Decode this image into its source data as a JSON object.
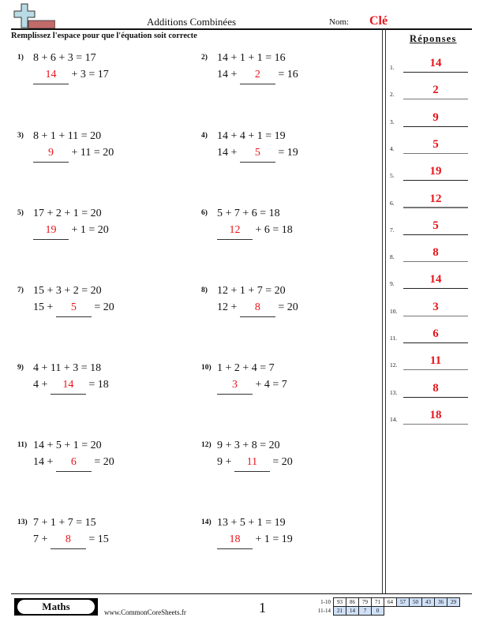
{
  "header": {
    "title": "Additions Combinées",
    "name_label": "Nom:",
    "name_value": "Clé",
    "instructions": "Remplissez l'espace pour que l'équation soit correcte",
    "logo_icon": "plus-sign-logo-icon"
  },
  "problems": [
    {
      "num": "1)",
      "line1": "8 + 6 + 3 = 17",
      "before": "",
      "answer": "14",
      "after": " + 3 = 17"
    },
    {
      "num": "2)",
      "line1": "14 + 1 + 1 = 16",
      "before": "14 + ",
      "answer": "2",
      "after": " = 16"
    },
    {
      "num": "3)",
      "line1": "8 + 1 + 11 = 20",
      "before": "",
      "answer": "9",
      "after": " + 11 = 20"
    },
    {
      "num": "4)",
      "line1": "14 + 4 + 1 = 19",
      "before": "14 + ",
      "answer": "5",
      "after": " = 19"
    },
    {
      "num": "5)",
      "line1": "17 + 2 + 1 = 20",
      "before": "",
      "answer": "19",
      "after": " + 1 = 20"
    },
    {
      "num": "6)",
      "line1": "5 + 7 + 6 = 18",
      "before": "",
      "answer": "12",
      "after": " + 6 = 18"
    },
    {
      "num": "7)",
      "line1": "15 + 3 + 2 = 20",
      "before": "15 + ",
      "answer": "5",
      "after": " = 20"
    },
    {
      "num": "8)",
      "line1": "12 + 1 + 7 = 20",
      "before": "12 + ",
      "answer": "8",
      "after": " = 20"
    },
    {
      "num": "9)",
      "line1": "4 + 11 + 3 = 18",
      "before": "4 + ",
      "answer": "14",
      "after": " = 18"
    },
    {
      "num": "10)",
      "line1": "1 + 2 + 4 = 7",
      "before": "",
      "answer": "3",
      "after": " + 4 = 7"
    },
    {
      "num": "11)",
      "line1": "14 + 5 + 1 = 20",
      "before": "14 + ",
      "answer": "6",
      "after": " = 20"
    },
    {
      "num": "12)",
      "line1": "9 + 3 + 8 = 20",
      "before": "9 + ",
      "answer": "11",
      "after": " = 20"
    },
    {
      "num": "13)",
      "line1": "7 + 1 + 7 = 15",
      "before": "7 + ",
      "answer": "8",
      "after": " = 15"
    },
    {
      "num": "14)",
      "line1": "13 + 5 + 1 = 19",
      "before": "",
      "answer": "18",
      "after": " + 1 = 19"
    }
  ],
  "answers": {
    "title": "Réponses",
    "items": [
      {
        "num": "1.",
        "value": "14"
      },
      {
        "num": "2.",
        "value": "2"
      },
      {
        "num": "3.",
        "value": "9"
      },
      {
        "num": "4.",
        "value": "5"
      },
      {
        "num": "5.",
        "value": "19"
      },
      {
        "num": "6.",
        "value": "12"
      },
      {
        "num": "7.",
        "value": "5"
      },
      {
        "num": "8.",
        "value": "8"
      },
      {
        "num": "9.",
        "value": "14"
      },
      {
        "num": "10.",
        "value": "3"
      },
      {
        "num": "11.",
        "value": "6"
      },
      {
        "num": "12.",
        "value": "11"
      },
      {
        "num": "13.",
        "value": "8"
      },
      {
        "num": "14.",
        "value": "18"
      }
    ]
  },
  "footer": {
    "subject": "Maths",
    "site": "www.CommonCoreSheets.fr",
    "page": "1",
    "score_rows": [
      {
        "label": "1-10",
        "cells": [
          "93",
          "86",
          "79",
          "71",
          "64",
          "57",
          "50",
          "43",
          "36",
          "29"
        ],
        "highlight_from": 5
      },
      {
        "label": "11-14",
        "cells": [
          "21",
          "14",
          "7",
          "0"
        ],
        "highlight_from": 0
      }
    ]
  },
  "colors": {
    "answer_red": "#e8141a",
    "score_highlight": "#cfe0f8"
  }
}
